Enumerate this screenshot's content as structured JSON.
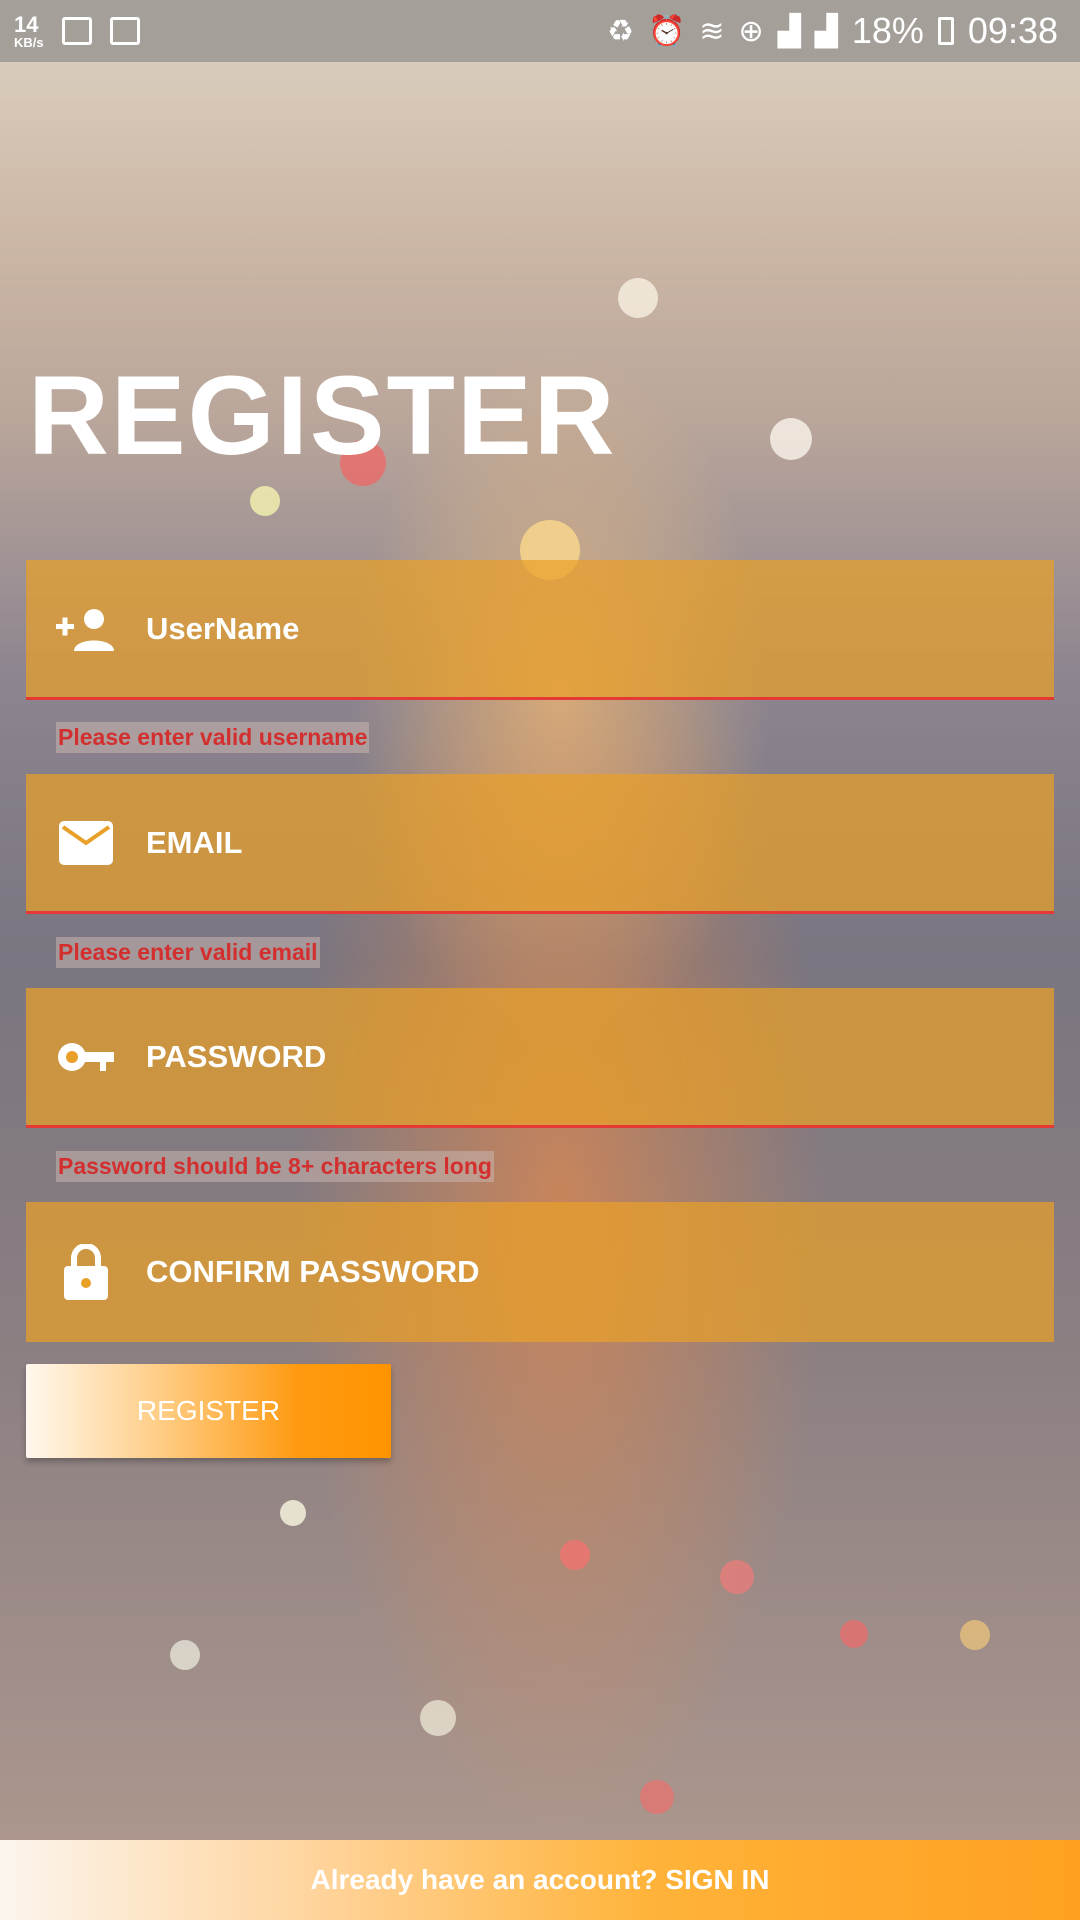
{
  "status_bar": {
    "speed_value": "14",
    "speed_unit": "KB/s",
    "battery": "18%",
    "time": "09:38"
  },
  "page_title": "REGISTER",
  "fields": {
    "username": {
      "placeholder": "UserName",
      "icon": "add-person-icon",
      "error": "Please enter valid username"
    },
    "email": {
      "placeholder": "EMAIL",
      "icon": "mail-icon",
      "error": "Please enter valid email"
    },
    "password": {
      "placeholder": "PASSWORD",
      "icon": "key-icon",
      "error": "Password should be 8+ characters long"
    },
    "confirm_password": {
      "placeholder": "CONFIRM PASSWORD",
      "icon": "lock-icon"
    }
  },
  "register_button": "REGISTER",
  "signin_link": "Already have an account? SIGN IN",
  "colors": {
    "field_bg": "#e9a028",
    "error": "#d32f2f",
    "accent": "#ff9400"
  }
}
